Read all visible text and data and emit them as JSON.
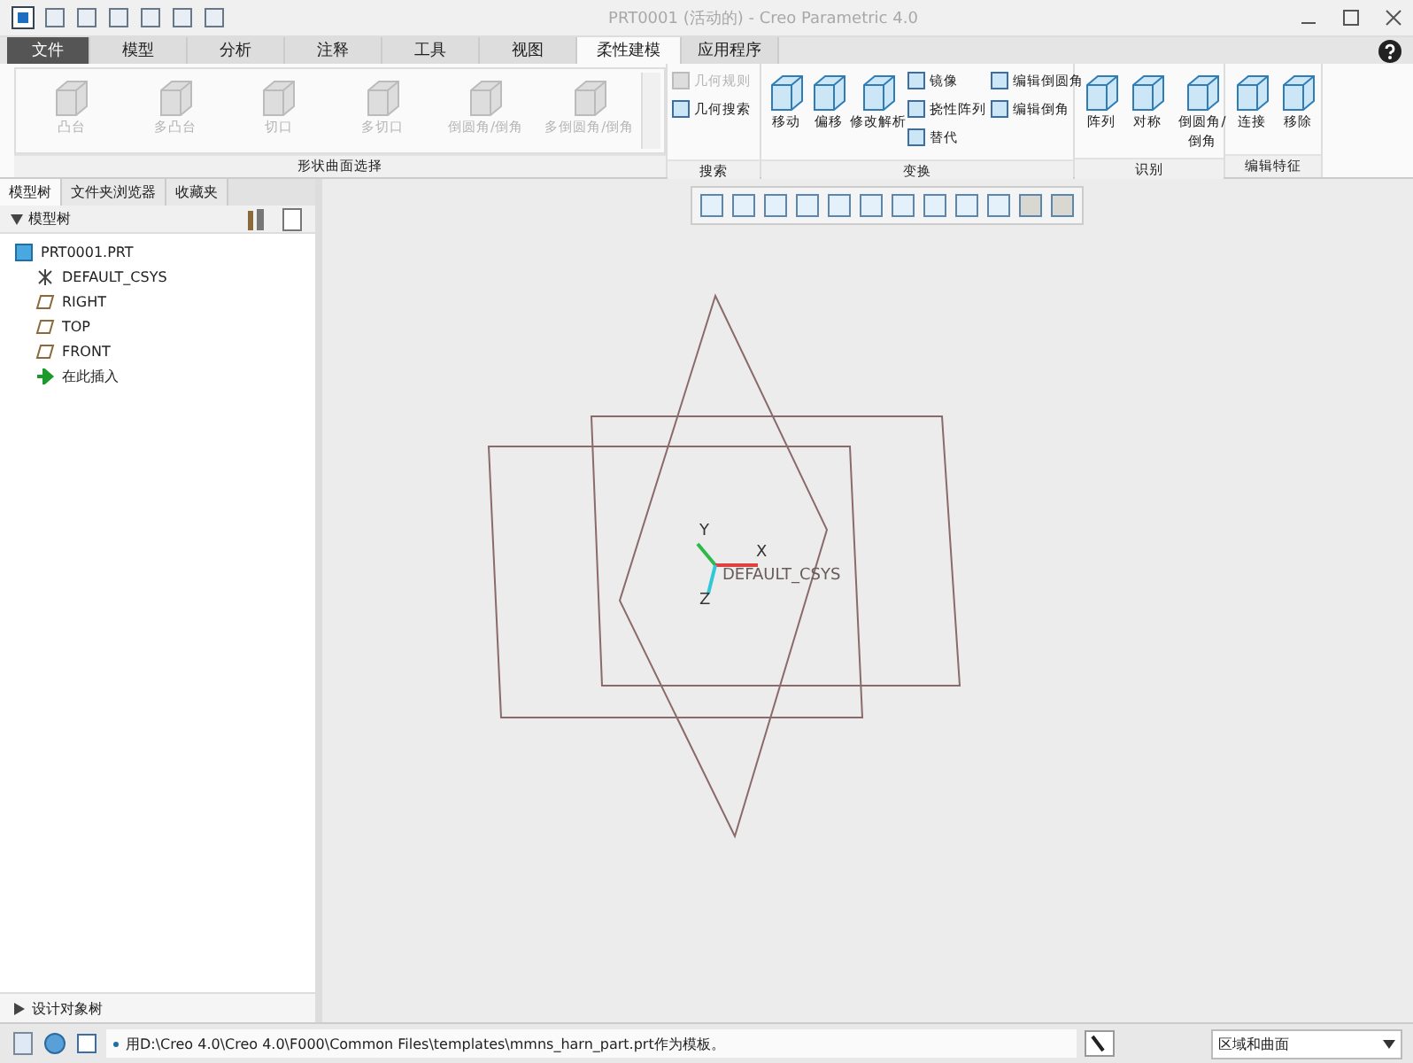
{
  "window": {
    "title": "PRT0001 (活动的) - Creo Parametric 4.0"
  },
  "tabs": [
    {
      "label": "文件",
      "kind": "file",
      "selected": false
    },
    {
      "label": "模型",
      "kind": "tab",
      "selected": false
    },
    {
      "label": "分析",
      "kind": "tab",
      "selected": false
    },
    {
      "label": "注释",
      "kind": "tab",
      "selected": false
    },
    {
      "label": "工具",
      "kind": "tab",
      "selected": false
    },
    {
      "label": "视图",
      "kind": "tab",
      "selected": false
    },
    {
      "label": "柔性建模",
      "kind": "tab",
      "selected": true
    },
    {
      "label": "应用程序",
      "kind": "tab",
      "selected": false
    }
  ],
  "ribbon": [
    {
      "label": "形状曲面选择",
      "large": [
        {
          "label": "凸台",
          "disabled": true
        },
        {
          "label": "多凸台",
          "disabled": true
        },
        {
          "label": "切口",
          "disabled": true
        },
        {
          "label": "多切口",
          "disabled": true
        },
        {
          "label": "倒圆角/倒角",
          "disabled": true
        },
        {
          "label": "多倒圆角/倒角",
          "disabled": true
        }
      ]
    },
    {
      "label": "搜索",
      "small": [
        {
          "label": "几何规则",
          "disabled": true
        },
        {
          "label": "几何搜索",
          "disabled": false
        }
      ]
    },
    {
      "label": "变换",
      "large": [
        {
          "label": "移动",
          "disabled": false
        },
        {
          "label": "偏移",
          "disabled": false
        },
        {
          "label": "修改解析",
          "disabled": false
        }
      ],
      "small": [
        {
          "label": "镜像",
          "disabled": false
        },
        {
          "label": "挠性阵列",
          "disabled": false
        },
        {
          "label": "替代",
          "disabled": false
        },
        {
          "label": "编辑倒圆角",
          "disabled": false
        },
        {
          "label": "编辑倒角",
          "disabled": false
        }
      ]
    },
    {
      "label": "识别",
      "large": [
        {
          "label": "阵列",
          "disabled": false
        },
        {
          "label": "对称",
          "disabled": false
        },
        {
          "label": "倒圆角/倒角",
          "disabled": false
        }
      ]
    },
    {
      "label": "编辑特征",
      "large": [
        {
          "label": "连接",
          "disabled": false
        },
        {
          "label": "移除",
          "disabled": false
        }
      ]
    }
  ],
  "panel_tabs": [
    {
      "label": "模型树",
      "selected": true
    },
    {
      "label": "文件夹浏览器",
      "selected": false
    },
    {
      "label": "收藏夹",
      "selected": false
    }
  ],
  "tree_header": "模型树",
  "tree": [
    {
      "label": "PRT0001.PRT",
      "kind": "part",
      "children": [
        {
          "label": "DEFAULT_CSYS",
          "kind": "csys"
        },
        {
          "label": "RIGHT",
          "kind": "plane"
        },
        {
          "label": "TOP",
          "kind": "plane"
        },
        {
          "label": "FRONT",
          "kind": "plane"
        },
        {
          "label": "在此插入",
          "kind": "insert"
        }
      ]
    }
  ],
  "design_tree": {
    "label": "设计对象树",
    "expanded": false
  },
  "canvas": {
    "axis_y": "Y",
    "axis_x": "X",
    "axis_z": "Z",
    "csys_label": "DEFAULT_CSYS"
  },
  "status_bar": {
    "message": "用D:\\Creo 4.0\\Creo 4.0\\F000\\Common Files\\templates\\mmns_harn_part.prt作为模板。",
    "filter": "区域和曲面"
  }
}
